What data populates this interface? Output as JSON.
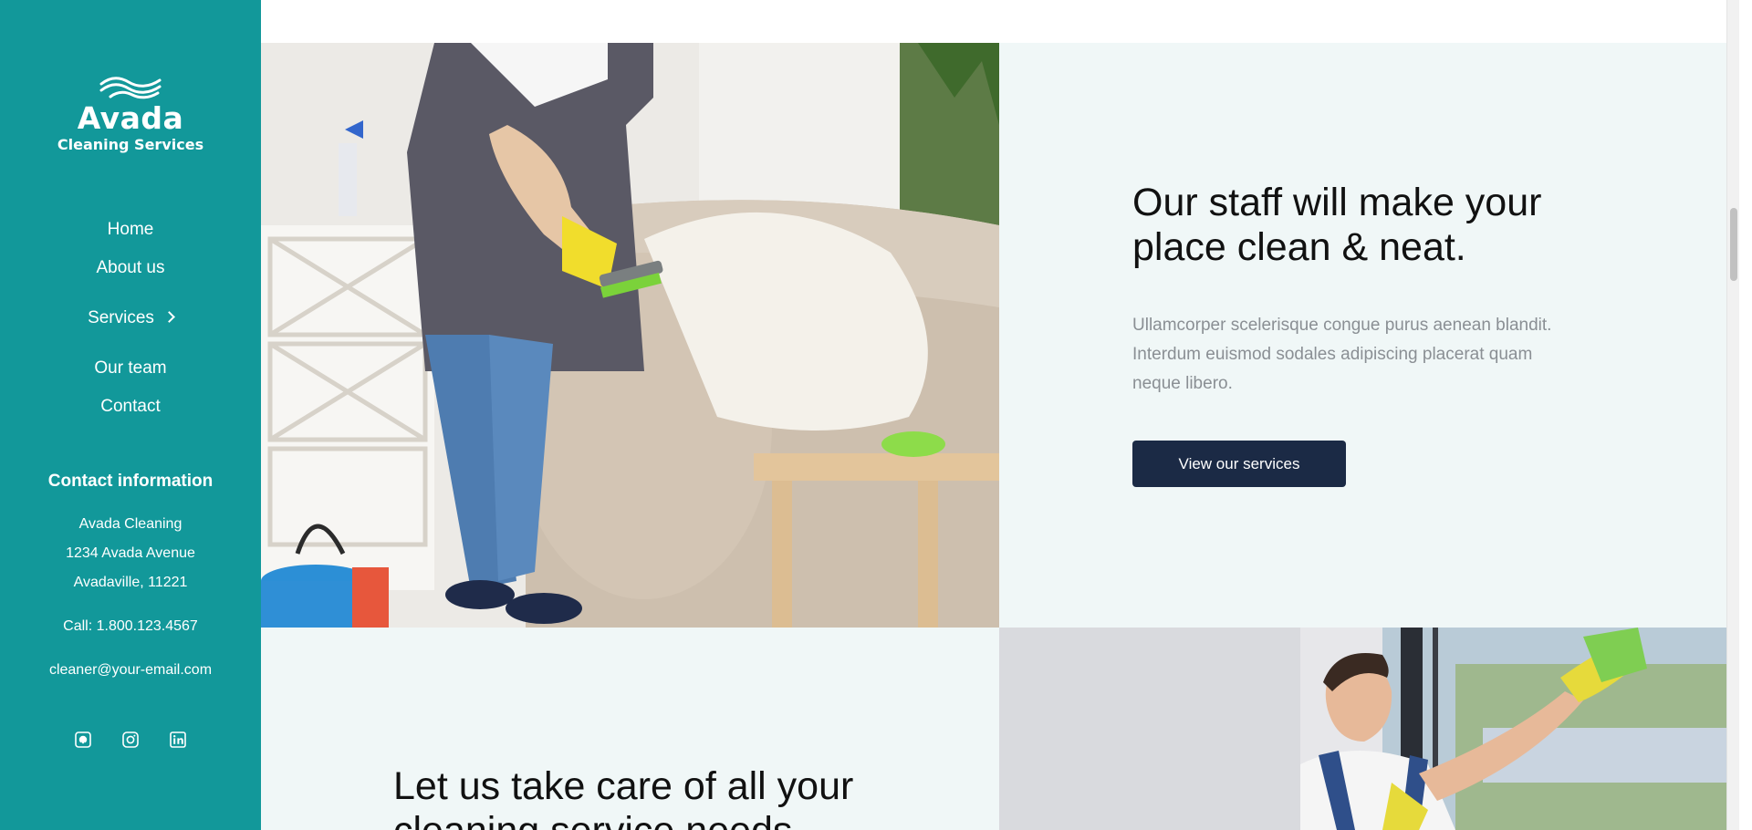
{
  "brand": {
    "title": "Avada",
    "subtitle": "Cleaning Services",
    "color": "#12989a",
    "logo_icon": "waves-icon"
  },
  "nav": {
    "items": [
      {
        "label": "Home"
      },
      {
        "label": "About us"
      },
      {
        "label": "Services",
        "icon": "chevron-right-icon"
      },
      {
        "label": "Our team"
      },
      {
        "label": "Contact"
      }
    ]
  },
  "contact": {
    "heading": "Contact information",
    "name": "Avada Cleaning",
    "street": "1234 Avada Avenue",
    "city": "Avadaville, 11221",
    "phone": "Call: 1.800.123.4567",
    "email": "cleaner@your-email.com"
  },
  "social": [
    {
      "icon": "github-icon"
    },
    {
      "icon": "instagram-icon"
    },
    {
      "icon": "linkedin-icon"
    }
  ],
  "section1": {
    "headline_line1": "Our staff will make your",
    "headline_line2": "place clean & neat.",
    "paragraph_line1": "Ullamcorper scelerisque congue purus aenean blandit.",
    "paragraph_line2": "Interdum euismod sodales adipiscing placerat quam",
    "paragraph_line3": "neque libero.",
    "button_label": "View our services",
    "button_color": "#1b2a45",
    "panel_color": "#f0f7f7"
  },
  "section2": {
    "headline_line1": "Let us take care of all your",
    "headline_line2": "cleaning service needs."
  }
}
